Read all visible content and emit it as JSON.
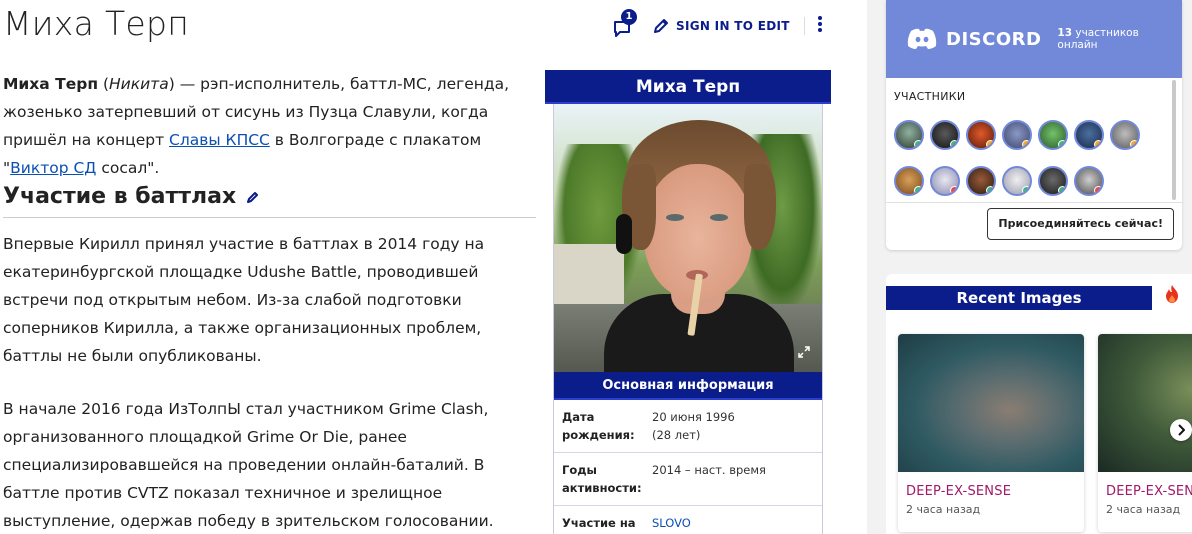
{
  "page": {
    "title": "Миха Терп",
    "comment_count": "1",
    "sign_in_label": "SIGN IN TO EDIT"
  },
  "intro": {
    "name_bold": "Миха Терп",
    "alias": "Никита",
    "text_1": " — рэп-исполнитель, баттл-МС, легенда, жозенько затерпевший от сисунь из Пузца Славули, когда пришёл на концерт ",
    "link_1": "Славы КПСС",
    "text_2": " в Волгограде с плакатом \"",
    "link_2": "Виктор СД",
    "text_3": " сосал\"."
  },
  "section": {
    "heading": "Участие в баттлах",
    "para_1": "Впервые Кирилл принял участие в баттлах в 2014 году на екатеринбургской площадке Udushe Battle, проводившей встречи под открытым небом. Из-за слабой подготовки соперников Кирилла, а также организационных проблем, баттлы не были опубликованы.",
    "para_2": "В начале 2016 года ИзТолпЫ стал участником Grime Clash, организованного площадкой Grime Or Die, ранее специализировавшейся на проведении онлайн-баталий. В баттле против CVTZ показал техничное и зрелищное выступление, одержав победу в зрительском голосовании."
  },
  "infobox": {
    "title": "Миха Терп",
    "section_label": "Основная информация",
    "rows": [
      {
        "label": "Дата рождения:",
        "value": "20 июня 1996",
        "value2": "(28 лет)"
      },
      {
        "label": "Годы активности:",
        "value": "2014 – наст. время",
        "value2": ""
      },
      {
        "label": "Участие на",
        "value": "SLOVO",
        "value2": ""
      }
    ]
  },
  "discord": {
    "brand": "DISCORD",
    "online_count": "13",
    "online_text": "участников онлайн",
    "members_label": "УЧАСТНИКИ",
    "join_label": "Присоединяйтесь сейчас!",
    "colors": {
      "header": "#7289da",
      "online": "#43b581",
      "idle": "#faa61a",
      "dnd": "#f04747"
    }
  },
  "recent": {
    "heading": "Recent Images",
    "cards": [
      {
        "title": "DEEP-EX-SENSE",
        "time": "2 часа назад"
      },
      {
        "title": "DEEP-EX-SENSE",
        "time": "2 часа назад"
      }
    ]
  },
  "icons": [
    "comment-icon",
    "pencil-icon",
    "more-icon",
    "discord-icon",
    "expand-icon",
    "fire-icon",
    "chevron-right-icon"
  ]
}
